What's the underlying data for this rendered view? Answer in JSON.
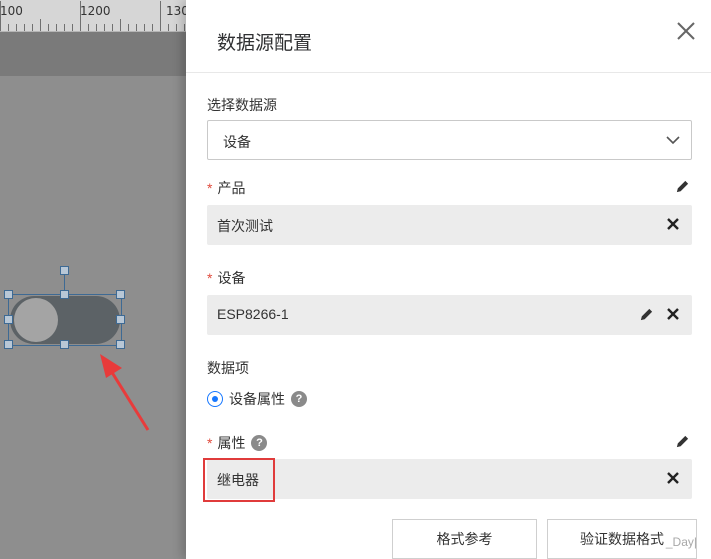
{
  "ruler": {
    "marks": [
      "100",
      "1200",
      "130"
    ]
  },
  "drawer": {
    "title": "数据源配置",
    "data_source_label": "选择数据源",
    "data_source_value": "设备",
    "product_label": "产品",
    "product_value": "首次测试",
    "device_label": "设备",
    "device_value": "ESP8266-1",
    "data_item_label": "数据项",
    "data_item_option": "设备属性",
    "property_label": "属性",
    "property_value": "继电器",
    "required_mark": "*",
    "help_glyph": "?"
  },
  "buttons": {
    "format_reference": "格式参考",
    "validate_format": "验证数据格式"
  },
  "watermark": "_Day|",
  "colors": {
    "accent": "#1677ff",
    "required": "#e04a3c",
    "highlight": "#e03b3b"
  }
}
